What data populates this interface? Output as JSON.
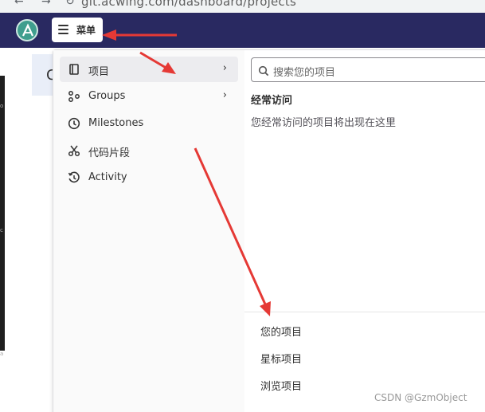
{
  "browser": {
    "url": "git.acwing.com/dashboard/projects"
  },
  "topbar": {
    "menu_label": "菜单"
  },
  "background": {
    "card_letter": "C",
    "strip_letters": [
      "o",
      "c",
      "a"
    ]
  },
  "dropdown": {
    "menu_items": [
      {
        "label": "项目",
        "icon": "project-icon",
        "has_submenu": true,
        "active": true
      },
      {
        "label": "Groups",
        "icon": "groups-icon",
        "has_submenu": true,
        "active": false
      },
      {
        "label": "Milestones",
        "icon": "clock-icon",
        "has_submenu": false,
        "active": false
      },
      {
        "label": "代码片段",
        "icon": "scissors-icon",
        "has_submenu": false,
        "active": false
      },
      {
        "label": "Activity",
        "icon": "history-icon",
        "has_submenu": false,
        "active": false
      }
    ],
    "search": {
      "placeholder": "搜索您的项目"
    },
    "frequent": {
      "title": "经常访问",
      "empty_text": "您经常访问的项目将出现在这里"
    },
    "links": [
      "您的项目",
      "星标项目",
      "浏览项目"
    ]
  },
  "watermark": "CSDN @GzmObject",
  "colors": {
    "topbar": "#292961",
    "arrow": "#e53935",
    "active_item": "#ececef"
  }
}
